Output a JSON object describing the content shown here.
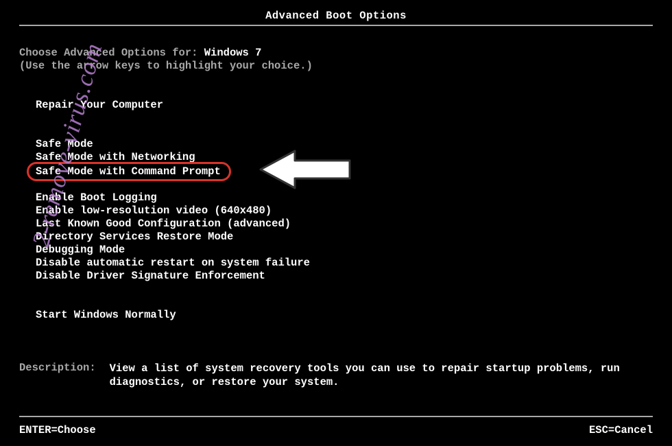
{
  "title": "Advanced Boot Options",
  "choose_prefix": "Choose Advanced Options for: ",
  "os_name": "Windows 7",
  "arrow_hint": "(Use the arrow keys to highlight your choice.)",
  "groups": {
    "repair": "Repair Your Computer",
    "safemode": [
      "Safe Mode",
      "Safe Mode with Networking",
      "Safe Mode with Command Prompt"
    ],
    "advanced": [
      "Enable Boot Logging",
      "Enable low-resolution video (640x480)",
      "Last Known Good Configuration (advanced)",
      "Directory Services Restore Mode",
      "Debugging Mode",
      "Disable automatic restart on system failure",
      "Disable Driver Signature Enforcement"
    ],
    "normal": "Start Windows Normally"
  },
  "highlighted_option": "Safe Mode with Command Prompt",
  "description_label": "Description:",
  "description_text": "View a list of system recovery tools you can use to repair startup problems, run diagnostics, or restore your system.",
  "footer": {
    "enter": "ENTER=Choose",
    "esc": "ESC=Cancel"
  },
  "watermark": "2-remove-virus.com",
  "colors": {
    "background": "#000000",
    "text_dim": "#a8a8a8",
    "text_bright": "#ffffff",
    "highlight_ring": "#d9332a",
    "watermark": "#b67fd1"
  }
}
